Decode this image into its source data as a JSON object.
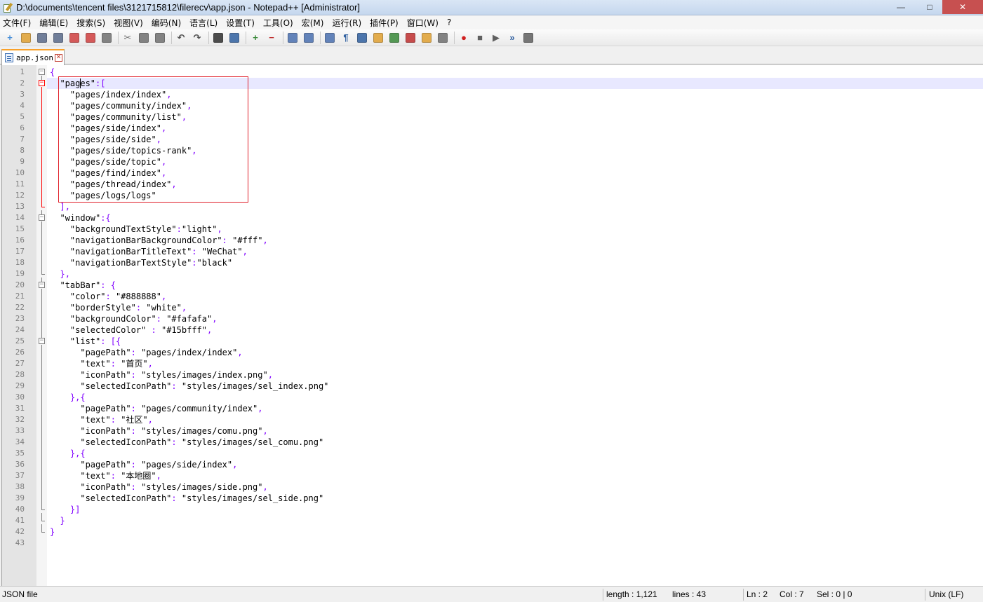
{
  "window": {
    "title": "D:\\documents\\tencent files\\3121715812\\filerecv\\app.json - Notepad++ [Administrator]",
    "minimize_glyph": "—",
    "maximize_glyph": "□",
    "close_glyph": "✕"
  },
  "menubar": {
    "items": [
      {
        "label": "文件(F)"
      },
      {
        "label": "编辑(E)"
      },
      {
        "label": "搜索(S)"
      },
      {
        "label": "视图(V)"
      },
      {
        "label": "编码(N)"
      },
      {
        "label": "语言(L)"
      },
      {
        "label": "设置(T)"
      },
      {
        "label": "工具(O)"
      },
      {
        "label": "宏(M)"
      },
      {
        "label": "运行(R)"
      },
      {
        "label": "插件(P)"
      },
      {
        "label": "窗口(W)"
      },
      {
        "label": "?"
      }
    ]
  },
  "toolbar": {
    "buttons": [
      {
        "icon": "new-file-icon",
        "color": "#4a90d9",
        "glyph": "+"
      },
      {
        "icon": "open-file-icon",
        "color": "#e0a030",
        "glyph": ""
      },
      {
        "icon": "save-icon",
        "color": "#5a6a8a",
        "glyph": ""
      },
      {
        "icon": "save-all-icon",
        "color": "#5a6a8a",
        "glyph": ""
      },
      {
        "icon": "close-file-icon",
        "color": "#d04040",
        "glyph": ""
      },
      {
        "icon": "close-all-icon",
        "color": "#d04040",
        "glyph": ""
      },
      {
        "icon": "print-icon",
        "color": "#707070",
        "glyph": ""
      },
      {
        "sep": true
      },
      {
        "icon": "cut-icon",
        "color": "#707070",
        "glyph": "✂"
      },
      {
        "icon": "copy-icon",
        "color": "#707070",
        "glyph": ""
      },
      {
        "icon": "paste-icon",
        "color": "#707070",
        "glyph": ""
      },
      {
        "sep": true
      },
      {
        "icon": "undo-icon",
        "color": "#505050",
        "glyph": "↶"
      },
      {
        "icon": "redo-icon",
        "color": "#505050",
        "glyph": "↷"
      },
      {
        "sep": true
      },
      {
        "icon": "find-icon",
        "color": "#303030",
        "glyph": ""
      },
      {
        "icon": "replace-icon",
        "color": "#3060a0",
        "glyph": ""
      },
      {
        "sep": true
      },
      {
        "icon": "zoom-in-icon",
        "color": "#3a8a3a",
        "glyph": "+"
      },
      {
        "icon": "zoom-out-icon",
        "color": "#c03030",
        "glyph": "−"
      },
      {
        "sep": true
      },
      {
        "icon": "sync-vertical-icon",
        "color": "#4a70b0",
        "glyph": ""
      },
      {
        "icon": "sync-horizontal-icon",
        "color": "#4a70b0",
        "glyph": ""
      },
      {
        "sep": true
      },
      {
        "icon": "word-wrap-icon",
        "color": "#4a70b0",
        "glyph": ""
      },
      {
        "icon": "show-all-chars-icon",
        "color": "#3060a0",
        "glyph": "¶"
      },
      {
        "icon": "indent-guide-icon",
        "color": "#3060a0",
        "glyph": ""
      },
      {
        "icon": "user-language-icon",
        "color": "#e0a030",
        "glyph": ""
      },
      {
        "icon": "doc-map-icon",
        "color": "#3a8a3a",
        "glyph": ""
      },
      {
        "icon": "function-list-icon",
        "color": "#c03030",
        "glyph": ""
      },
      {
        "icon": "folder-workspace-icon",
        "color": "#e0a030",
        "glyph": ""
      },
      {
        "icon": "monitoring-icon",
        "color": "#707070",
        "glyph": ""
      },
      {
        "sep": true
      },
      {
        "icon": "record-macro-icon",
        "color": "#d02020",
        "glyph": "●"
      },
      {
        "icon": "stop-record-icon",
        "color": "#606060",
        "glyph": "■"
      },
      {
        "icon": "play-macro-icon",
        "color": "#606060",
        "glyph": "▶"
      },
      {
        "icon": "play-multiple-icon",
        "color": "#3060a0",
        "glyph": "»"
      },
      {
        "icon": "save-macro-icon",
        "color": "#606060",
        "glyph": ""
      }
    ]
  },
  "tabs": [
    {
      "label": "app.json",
      "close_glyph": "✕"
    }
  ],
  "editor": {
    "current_line": 2,
    "lines": [
      {
        "n": "1",
        "text": "{"
      },
      {
        "n": "2",
        "text": "  \"pages\":["
      },
      {
        "n": "3",
        "text": "    \"pages/index/index\","
      },
      {
        "n": "4",
        "text": "    \"pages/community/index\","
      },
      {
        "n": "5",
        "text": "    \"pages/community/list\","
      },
      {
        "n": "6",
        "text": "    \"pages/side/index\","
      },
      {
        "n": "7",
        "text": "    \"pages/side/side\","
      },
      {
        "n": "8",
        "text": "    \"pages/side/topics-rank\","
      },
      {
        "n": "9",
        "text": "    \"pages/side/topic\","
      },
      {
        "n": "10",
        "text": "    \"pages/find/index\","
      },
      {
        "n": "11",
        "text": "    \"pages/thread/index\","
      },
      {
        "n": "12",
        "text": "    \"pages/logs/logs\""
      },
      {
        "n": "13",
        "text": "  ],"
      },
      {
        "n": "14",
        "text": "  \"window\":{"
      },
      {
        "n": "15",
        "text": "    \"backgroundTextStyle\":\"light\","
      },
      {
        "n": "16",
        "text": "    \"navigationBarBackgroundColor\": \"#fff\","
      },
      {
        "n": "17",
        "text": "    \"navigationBarTitleText\": \"WeChat\","
      },
      {
        "n": "18",
        "text": "    \"navigationBarTextStyle\":\"black\""
      },
      {
        "n": "19",
        "text": "  },"
      },
      {
        "n": "20",
        "text": "  \"tabBar\": {"
      },
      {
        "n": "21",
        "text": "    \"color\": \"#888888\","
      },
      {
        "n": "22",
        "text": "    \"borderStyle\": \"white\","
      },
      {
        "n": "23",
        "text": "    \"backgroundColor\": \"#fafafa\","
      },
      {
        "n": "24",
        "text": "    \"selectedColor\" : \"#15bfff\","
      },
      {
        "n": "25",
        "text": "    \"list\": [{"
      },
      {
        "n": "26",
        "text": "      \"pagePath\": \"pages/index/index\","
      },
      {
        "n": "27",
        "text": "      \"text\": \"首页\","
      },
      {
        "n": "28",
        "text": "      \"iconPath\": \"styles/images/index.png\","
      },
      {
        "n": "29",
        "text": "      \"selectedIconPath\": \"styles/images/sel_index.png\""
      },
      {
        "n": "30",
        "text": "    },{"
      },
      {
        "n": "31",
        "text": "      \"pagePath\": \"pages/community/index\","
      },
      {
        "n": "32",
        "text": "      \"text\": \"社区\","
      },
      {
        "n": "33",
        "text": "      \"iconPath\": \"styles/images/comu.png\","
      },
      {
        "n": "34",
        "text": "      \"selectedIconPath\": \"styles/images/sel_comu.png\""
      },
      {
        "n": "35",
        "text": "    },{"
      },
      {
        "n": "36",
        "text": "      \"pagePath\": \"pages/side/index\","
      },
      {
        "n": "37",
        "text": "      \"text\": \"本地圈\","
      },
      {
        "n": "38",
        "text": "      \"iconPath\": \"styles/images/side.png\","
      },
      {
        "n": "39",
        "text": "      \"selectedIconPath\": \"styles/images/sel_side.png\""
      },
      {
        "n": "40",
        "text": "    }]"
      },
      {
        "n": "41",
        "text": "  }"
      },
      {
        "n": "42",
        "text": "}"
      },
      {
        "n": "43",
        "text": ""
      }
    ]
  },
  "statusbar": {
    "file_type": "JSON file",
    "length": "length : 1,121",
    "lines": "lines : 43",
    "ln": "Ln : 2",
    "col": "Col : 7",
    "sel": "Sel : 0 | 0",
    "eol": "Unix (LF)"
  },
  "colors": {
    "string": "#808080",
    "key_string": "#000000",
    "operator": "#8000ff",
    "fold_active": "#ff0000",
    "current_line_bg": "#e8e8ff",
    "selection_box": "#e0202a"
  }
}
